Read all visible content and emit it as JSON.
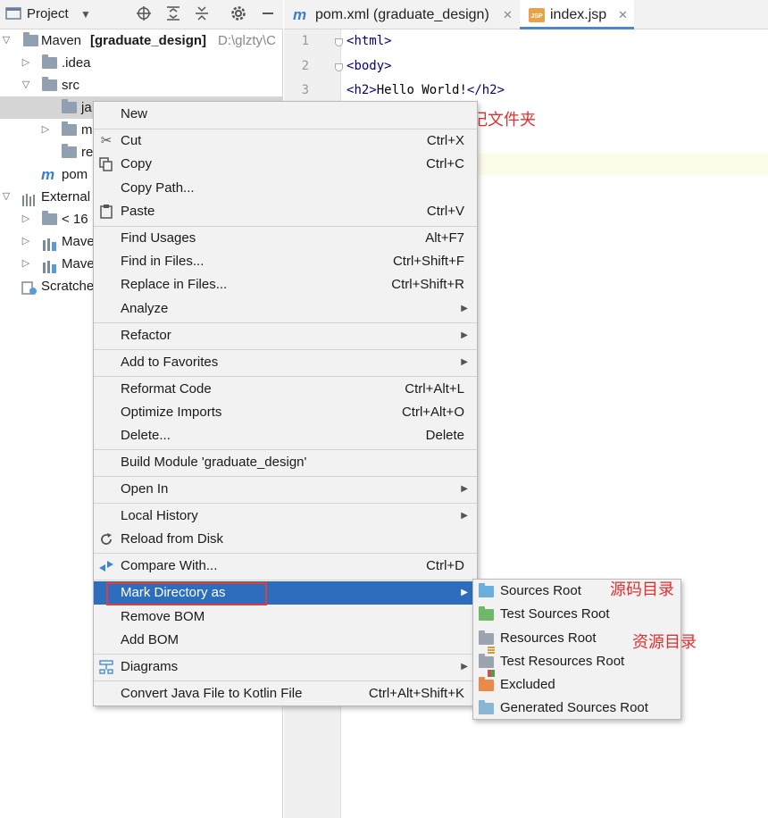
{
  "colors": {
    "accent": "#2d6dbd",
    "annotation": "#e03030",
    "folder": "#90a0b0",
    "sources_root": "#6aaedb",
    "test_sources_root": "#6fb86a",
    "excluded": "#e88a4a"
  },
  "project": {
    "title": "Project",
    "icons": [
      "project-icon",
      "chevron-down-icon",
      "locate-icon",
      "expand-all-icon",
      "collapse-all-icon",
      "gear-icon",
      "minimize-icon"
    ],
    "tree": {
      "root_prefix": "Maven ",
      "root_name": "[graduate_design]",
      "root_path": "D:\\glzty\\C",
      "idea": ".idea",
      "src": "src",
      "java_truncated": "ja",
      "main_truncated": "m",
      "resources_truncated": "re",
      "pom_truncated": "pom",
      "external_truncated": "External",
      "jdk_truncated": "< 16",
      "maven1_truncated": "Mave",
      "maven2_truncated": "Mave",
      "scratches_truncated": "Scratche"
    }
  },
  "editor": {
    "tabs": [
      {
        "label": "pom.xml (graduate_design)",
        "icon": "maven-icon"
      },
      {
        "label": "index.jsp",
        "icon": "jsp-icon",
        "icon_text": "JSP"
      }
    ],
    "lines": [
      {
        "no": "1",
        "open": "<",
        "tag": "html",
        "close": ">"
      },
      {
        "no": "2",
        "open": "<",
        "tag": "body",
        "close": ">"
      },
      {
        "no": "3",
        "pre_open": "<",
        "pre_tag": "h2",
        "pre_close": ">",
        "text": "Hello World!",
        "post_open": "</",
        "post_tag": "h2",
        "post_close": ">"
      }
    ]
  },
  "menu": {
    "new": "New",
    "cut": "Cut",
    "cut_key": "Ctrl+X",
    "copy": "Copy",
    "copy_key": "Ctrl+C",
    "copy_path": "Copy Path...",
    "paste": "Paste",
    "paste_key": "Ctrl+V",
    "find_usages": "Find Usages",
    "find_usages_key": "Alt+F7",
    "find_in_files": "Find in Files...",
    "find_in_files_key": "Ctrl+Shift+F",
    "replace_in_files": "Replace in Files...",
    "replace_in_files_key": "Ctrl+Shift+R",
    "analyze": "Analyze",
    "refactor": "Refactor",
    "add_to_favorites": "Add to Favorites",
    "reformat_code": "Reformat Code",
    "reformat_code_key": "Ctrl+Alt+L",
    "optimize_imports": "Optimize Imports",
    "optimize_imports_key": "Ctrl+Alt+O",
    "delete": "Delete...",
    "delete_key": "Delete",
    "build_module": "Build Module 'graduate_design'",
    "open_in": "Open In",
    "local_history": "Local History",
    "reload_from_disk": "Reload from Disk",
    "compare_with": "Compare With...",
    "compare_with_key": "Ctrl+D",
    "mark_directory_as": "Mark Directory as",
    "remove_bom": "Remove BOM",
    "add_bom": "Add BOM",
    "diagrams": "Diagrams",
    "convert_java": "Convert Java File to Kotlin File",
    "convert_java_key": "Ctrl+Alt+Shift+K"
  },
  "submenu": {
    "sources_root": "Sources Root",
    "test_sources_root": "Test Sources Root",
    "resources_root": "Resources Root",
    "test_resources_root": "Test Resources Root",
    "excluded": "Excluded",
    "generated_sources_root": "Generated Sources Root"
  },
  "annotations": {
    "top": "添加了java 和resource目录，让后标记文件夹",
    "sources": "源码目录",
    "resources": "资源目录"
  }
}
